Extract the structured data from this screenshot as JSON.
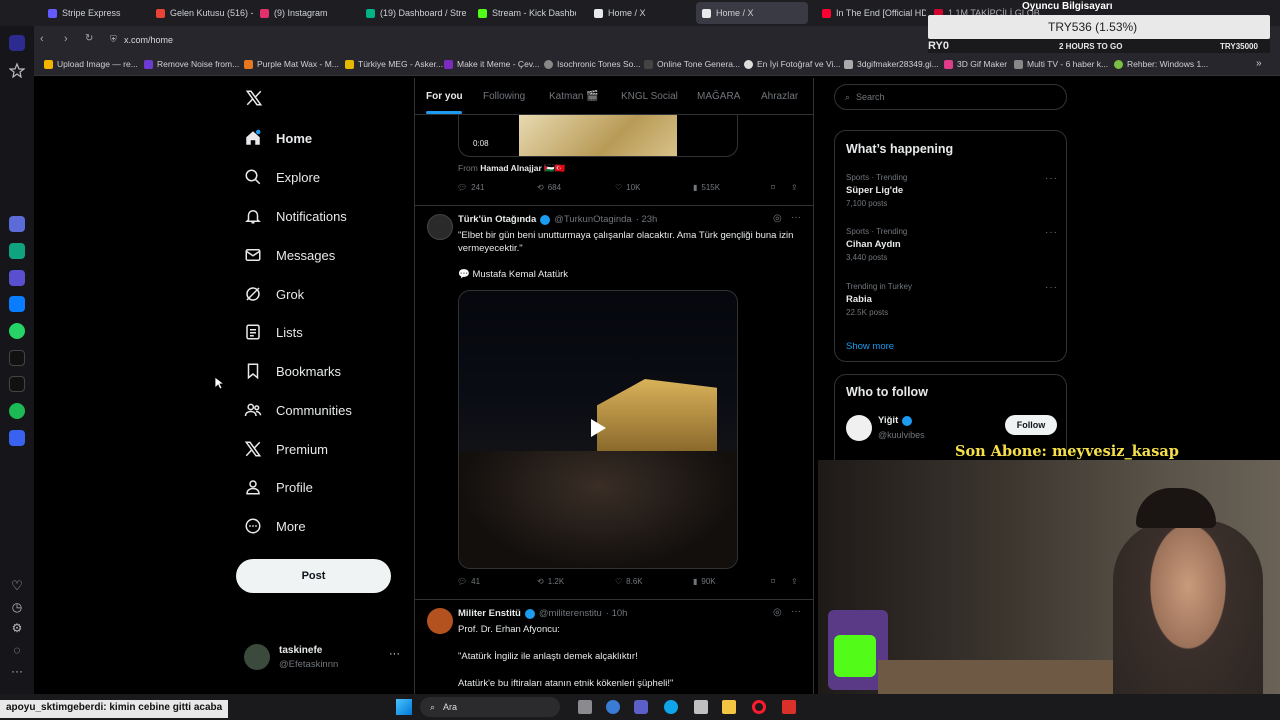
{
  "browser": {
    "tabs": [
      {
        "label": "Stripe Express",
        "color": "#635bff"
      },
      {
        "label": "Gelen Kutusu (516) - no",
        "color": "#ea4335"
      },
      {
        "label": "(9) Instagram",
        "color": "#e1306c"
      },
      {
        "label": "(19) Dashboard / Stream",
        "color": "#00b386"
      },
      {
        "label": "Stream - Kick Dashboar",
        "color": "#53fc18"
      },
      {
        "label": "Home / X",
        "color": "#e7e9ea"
      },
      {
        "label": "Home / X",
        "color": "#e7e9ea"
      },
      {
        "label": "In The End [Official HD",
        "color": "#ff0033"
      },
      {
        "label": "1.1M TAKİPÇİLİ GLOBAL",
        "color": "#ff0033"
      }
    ],
    "url": "x.com/home",
    "bookmarks": [
      "Upload Image — re...",
      "Remove Noise from...",
      "Purple Mat Wax - M...",
      "Türkiye MEG - Asker...",
      "Make it Meme - Çev...",
      "Isochronic Tones So...",
      "Online Tone Genera...",
      "En İyi Fotoğraf ve Vi...",
      "3dgifmaker28349.gi...",
      "3D Gif Maker",
      "Multi TV - 6 haber k...",
      "Rehber: Windows 1..."
    ]
  },
  "overlay": {
    "ticker_title": "Oyuncu Bilgisayarı",
    "ticker_value": "TRY536 (1.53%)",
    "ticker_left": "RY0",
    "ticker_mid": "2 HOURS TO GO",
    "ticker_right": "TRY35000",
    "last_sub": "Son Abone: meyvesiz_kasap",
    "chat_user": "apoyu_sktimgeberdi",
    "chat_text": ": kimin cebine gitti acaba"
  },
  "sidebar": {
    "items": [
      {
        "label": "Home",
        "icon": "home-icon"
      },
      {
        "label": "Explore",
        "icon": "search-icon"
      },
      {
        "label": "Notifications",
        "icon": "bell-icon"
      },
      {
        "label": "Messages",
        "icon": "mail-icon"
      },
      {
        "label": "Grok",
        "icon": "grok-icon"
      },
      {
        "label": "Lists",
        "icon": "list-icon"
      },
      {
        "label": "Bookmarks",
        "icon": "bookmark-icon"
      },
      {
        "label": "Communities",
        "icon": "people-icon"
      },
      {
        "label": "Premium",
        "icon": "x-logo-icon"
      },
      {
        "label": "Profile",
        "icon": "person-icon"
      },
      {
        "label": "More",
        "icon": "more-circle-icon"
      }
    ],
    "post_label": "Post",
    "account": {
      "name": "taskinefe",
      "handle": "@Efetaskinnn"
    }
  },
  "feed": {
    "tabs": [
      "For you",
      "Following",
      "Katman 🎬",
      "KNGL Social",
      "MAĞARA",
      "Ahrazlar"
    ],
    "tweet1": {
      "video_time": "0:08",
      "from_prefix": "From",
      "from_name": "Hamad Alnajjar 🇵🇸🇹🇷",
      "replies": "241",
      "reposts": "684",
      "likes": "10K",
      "views": "515K"
    },
    "tweet2": {
      "name": "Türk'ün Otağında",
      "handle": "@TurkunOtaginda",
      "time": "· 23h",
      "text": "\"Elbet bir gün beni unutturmaya çalışanlar olacaktır. Ama Türk gençliği buna izin vermeyecektir.\"",
      "quote": "💬 Mustafa Kemal Atatürk",
      "replies": "41",
      "reposts": "1.2K",
      "likes": "8.6K",
      "views": "90K"
    },
    "tweet3": {
      "name": "Militer Enstitü",
      "handle": "@militerenstitu",
      "time": "· 10h",
      "line1": "Prof. Dr. Erhan Afyoncu:",
      "line2": "\"Atatürk İngiliz ile anlaştı demek alçaklıktır!",
      "line3": "Atatürk'e bu iftiraları atanın etnik kökenleri şüpheli!\""
    }
  },
  "right": {
    "search_placeholder": "Search",
    "happening_title": "What’s happening",
    "trends": [
      {
        "category": "Sports · Trending",
        "name": "Süper Lig'de",
        "count": "7,100 posts"
      },
      {
        "category": "Sports · Trending",
        "name": "Cihan Aydın",
        "count": "3,440 posts"
      },
      {
        "category": "Trending in Turkey",
        "name": "Rabia",
        "count": "22.5K posts"
      }
    ],
    "show_more": "Show more",
    "follow_title": "Who to follow",
    "suggest": {
      "name": "Yiğit",
      "handle": "@kuulvibes",
      "button": "Follow"
    }
  },
  "taskbar": {
    "search": "Ara"
  },
  "colors": {
    "accent": "#1d9bf0",
    "bg": "#000000",
    "border": "#2f3336",
    "muted": "#71767b",
    "text": "#e7e9ea"
  }
}
